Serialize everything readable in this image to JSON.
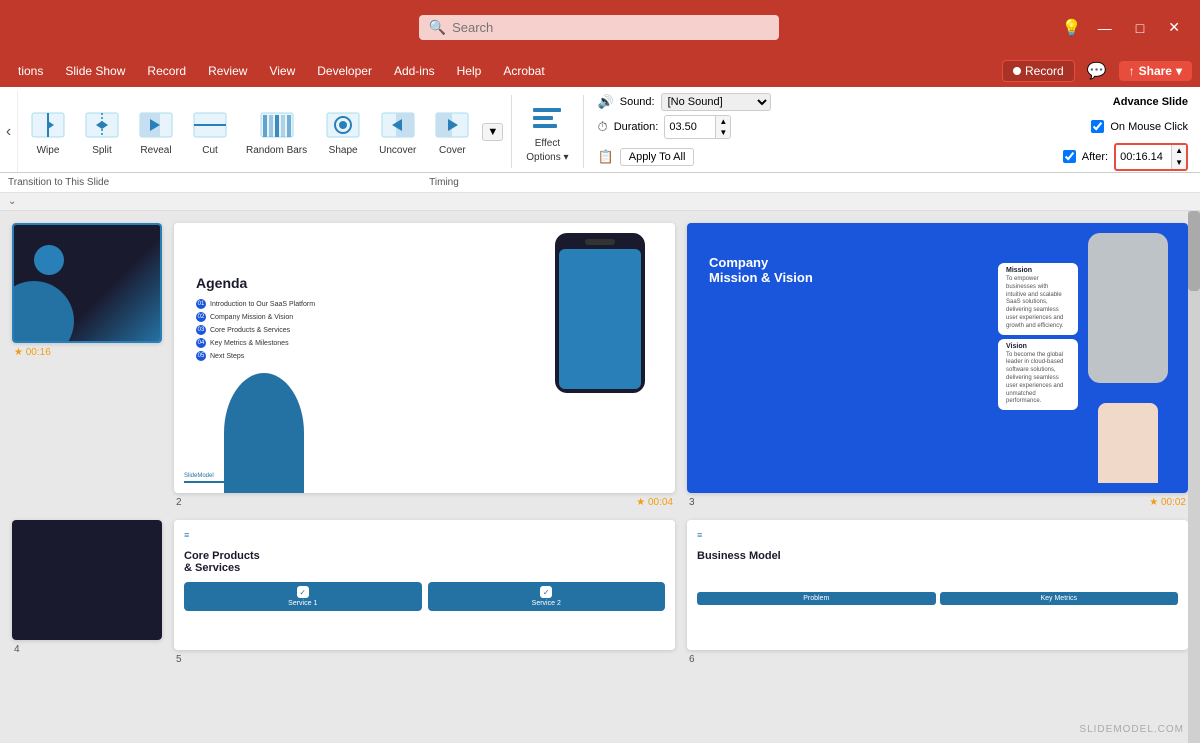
{
  "titlebar": {
    "search_placeholder": "Search",
    "lightbulb_icon": "💡",
    "minimize_icon": "—",
    "maximize_icon": "□",
    "close_icon": "✕"
  },
  "menubar": {
    "items": [
      "tions",
      "Slide Show",
      "Record",
      "Review",
      "View",
      "Developer",
      "Add-ins",
      "Help",
      "Acrobat"
    ],
    "record_btn": "Record",
    "share_btn": "Share",
    "comment_icon": "💬"
  },
  "ribbon": {
    "transition_label": "Transition to This Slide",
    "timing_label": "Timing",
    "transitions": [
      {
        "id": "wipe",
        "label": "Wipe",
        "icon": "←"
      },
      {
        "id": "split",
        "label": "Split",
        "icon": "↔"
      },
      {
        "id": "reveal",
        "label": "Reveal",
        "icon": "↗"
      },
      {
        "id": "cut",
        "label": "Cut",
        "icon": "✂"
      },
      {
        "id": "random-bars",
        "label": "Random Bars",
        "icon": "⬚"
      },
      {
        "id": "shape",
        "label": "Shape",
        "icon": "○"
      },
      {
        "id": "uncover",
        "label": "Uncover",
        "icon": "←"
      },
      {
        "id": "cover",
        "label": "Cover",
        "icon": "→"
      }
    ],
    "effect_options": {
      "label": "Effect Options",
      "icon": "▼"
    },
    "sound_label": "Sound:",
    "sound_value": "[No Sound]",
    "duration_label": "Duration:",
    "duration_value": "03.50",
    "apply_to_all": "Apply To All",
    "advance_slide": "Advance Slide",
    "on_mouse_click": "On Mouse Click",
    "after_label": "After:",
    "after_value": "00:16.14"
  },
  "slides": [
    {
      "num": "",
      "star": "★",
      "time": "00:16",
      "content": "slide1"
    },
    {
      "num": "2",
      "star": "★",
      "time": "00:04",
      "content": "slide2",
      "title": "Agenda",
      "list": [
        "Introduction to Our SaaS Platform",
        "Company Mission & Vision",
        "Core Products & Services",
        "Key Metrics & Milestones",
        "Next Steps"
      ]
    },
    {
      "num": "3",
      "star": "★",
      "time": "00:02",
      "content": "slide3",
      "title": "Company Mission & Vision",
      "cards": [
        {
          "title": "Mission",
          "text": "To empower businesses with intuitive and scalable SaaS solutions, delivering seamless user experiences and growth and efficiency."
        },
        {
          "title": "Vision",
          "text": "To become the global leader in cloud-based software solutions, delivering seamless user experiences and unmatched performance."
        }
      ]
    },
    {
      "num": "4",
      "content": "slide4",
      "title": "Core Products & Services",
      "items": [
        "Service 1",
        "Service 2"
      ]
    },
    {
      "num": "5",
      "content": "slide5",
      "title": "Business Model",
      "btns": [
        "Problem",
        "Key Metrics"
      ]
    }
  ],
  "watermark": "SLIDEMODEL.COM"
}
